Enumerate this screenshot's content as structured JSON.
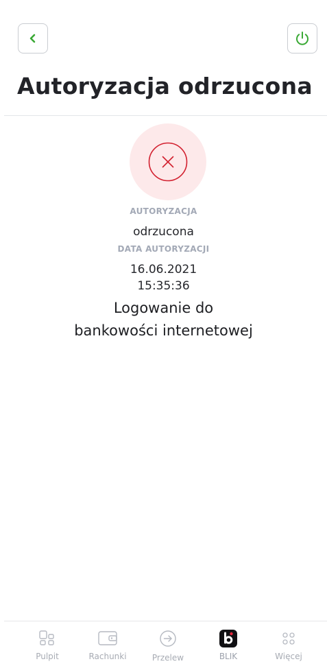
{
  "header": {
    "title": "Autoryzacja odrzucona",
    "back_icon": "chevron-left-icon",
    "power_icon": "power-icon",
    "accent_color": "#3aa935"
  },
  "status": {
    "icon": "close-circle-icon",
    "color": "#d2202f",
    "background": "#fde9ea"
  },
  "details": {
    "authorization_label": "AUTORYZACJA",
    "authorization_value": "odrzucona",
    "date_label": "DATA AUTORYZACJI",
    "date_value": "16.06.2021",
    "time_value": "15:35:36",
    "description_line1": "Logowanie do",
    "description_line2": "bankowości internetowej"
  },
  "nav": {
    "items": [
      {
        "label": "Pulpit",
        "icon": "dashboard-icon"
      },
      {
        "label": "Rachunki",
        "icon": "wallet-icon"
      },
      {
        "label": "Przelew",
        "icon": "transfer-icon"
      },
      {
        "label": "BLIK",
        "icon": "blik-icon"
      },
      {
        "label": "Więcej",
        "icon": "more-icon"
      }
    ]
  }
}
